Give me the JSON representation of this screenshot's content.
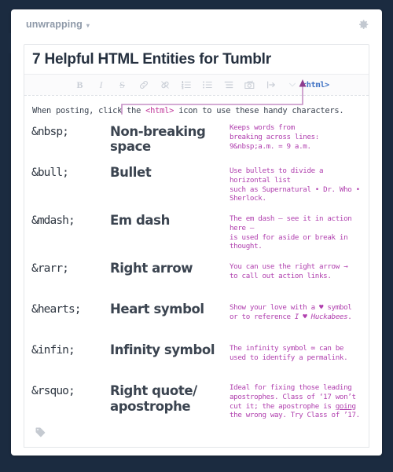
{
  "window": {
    "background_color": "#1b2b40",
    "card_background": "#ffffff"
  },
  "header": {
    "blog_name": "unwrapping",
    "caret": "▾",
    "settings_icon": "gear-icon"
  },
  "editor": {
    "post_title": "7 Helpful HTML Entities for Tumblr",
    "toolbar": {
      "buttons": [
        {
          "name": "bold",
          "label": "B"
        },
        {
          "name": "italic",
          "label": "I"
        },
        {
          "name": "strikethrough",
          "label": "S"
        },
        {
          "name": "link",
          "label": ""
        },
        {
          "name": "unlink",
          "label": ""
        },
        {
          "name": "ordered-list",
          "label": ""
        },
        {
          "name": "unordered-list",
          "label": ""
        },
        {
          "name": "blockquote",
          "label": ""
        },
        {
          "name": "insert-photo",
          "label": ""
        },
        {
          "name": "read-more",
          "label": ""
        },
        {
          "name": "more-options",
          "label": ""
        }
      ],
      "html_button_label": "<html>",
      "html_button_color": "#3f72c4"
    },
    "intro": {
      "before": "When posting, click the ",
      "token": "<html>",
      "after": " icon to use these handy characters."
    },
    "annotation_color": "#c58fc5"
  },
  "entities": [
    {
      "code": "&nbsp;",
      "name": "Non-breaking space",
      "description": "Keeps words from\nbreaking across lines:\n9&nbsp;a.m. = 9 a.m."
    },
    {
      "code": "&bull;",
      "name": "Bullet",
      "description": "Use bullets to divide a horizontal list\nsuch as Supernatural • Dr. Who • Sherlock."
    },
    {
      "code": "&mdash;",
      "name": "Em dash",
      "description": "The em dash — see it in action here —\nis used for aside or break in thought."
    },
    {
      "code": "&rarr;",
      "name": "Right arrow",
      "description": "You can use the right arrow →\nto call out action links."
    },
    {
      "code": "&hearts;",
      "name": "Heart symbol",
      "description_line1": "Show your love with a ♥ symbol",
      "description_line2_plain": "or to reference ",
      "description_line2_italic": "I ♥ Huckabees",
      "description_line2_tail": "."
    },
    {
      "code": "&infin;",
      "name": "Infinity symbol",
      "description": "The infinity symbol ∞ can be\nused to identify a permalink."
    },
    {
      "code": "&rsquo;",
      "name": "Right quote/\napostrophe",
      "description_line1": "Ideal for fixing those leading",
      "description_line2": "apostrophes. Class of ‘17 won’t",
      "description_line3_a": "cut it; the apostrophe is ",
      "description_line3_underline": "going",
      "description_line4": "the wrong way. Try Class of ’17."
    }
  ],
  "footer": {
    "tag_icon": "tag-icon"
  },
  "colors": {
    "entity_code": "#2f3742",
    "entity_name": "#3b4450",
    "entity_description": "#b03fae",
    "html_token": "#c0399a",
    "title": "#25303f",
    "blog_name": "#8e99a8"
  }
}
